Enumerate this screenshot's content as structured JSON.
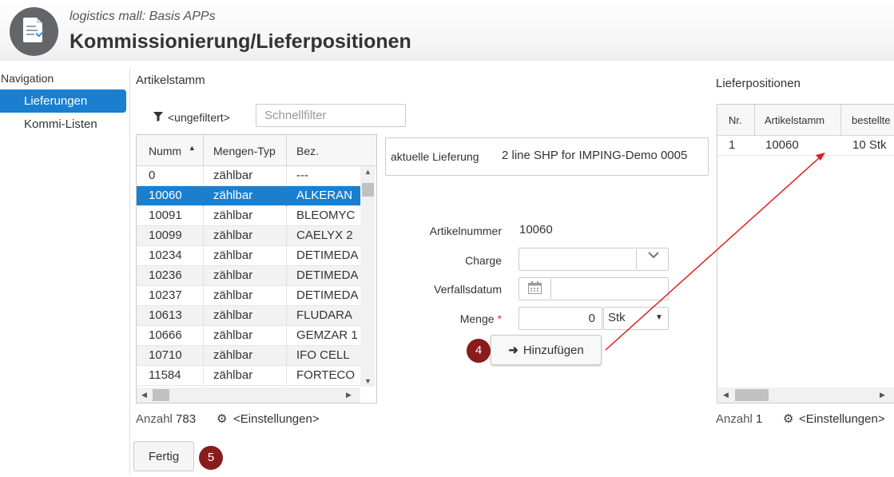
{
  "header": {
    "subtitle": "logistics mall: Basis APPs",
    "title": "Kommissionierung/Lieferpositionen"
  },
  "navigation": {
    "label": "Navigation",
    "items": [
      {
        "label": "Lieferungen",
        "active": true
      },
      {
        "label": "Kommi-Listen",
        "active": false
      }
    ]
  },
  "artikelstamm": {
    "title": "Artikelstamm",
    "filter_label": "<ungefiltert>",
    "quickfilter_placeholder": "Schnellfilter",
    "columns": [
      "Nummer",
      "Mengen-Typ",
      "Bez."
    ],
    "rows": [
      [
        "0",
        "zählbar",
        "---"
      ],
      [
        "10060",
        "zählbar",
        "ALKERAN"
      ],
      [
        "10091",
        "zählbar",
        "BLEOMYC"
      ],
      [
        "10099",
        "zählbar",
        "CAELYX 2"
      ],
      [
        "10234",
        "zählbar",
        "DETIMEDA"
      ],
      [
        "10236",
        "zählbar",
        "DETIMEDA"
      ],
      [
        "10237",
        "zählbar",
        "DETIMEDA"
      ],
      [
        "10613",
        "zählbar",
        "FLUDARA"
      ],
      [
        "10666",
        "zählbar",
        "GEMZAR 1"
      ],
      [
        "10710",
        "zählbar",
        "IFO CELL"
      ],
      [
        "11584",
        "zählbar",
        "FORTECO"
      ]
    ],
    "selected_row": 1,
    "count_label": "Anzahl",
    "count": "783",
    "settings_label": "<Einstellungen>"
  },
  "form": {
    "current_delivery_label": "aktuelle Lieferung",
    "current_delivery_value": "2 line SHP for IMPING-Demo 0005",
    "artikelnummer_label": "Artikelnummer",
    "artikelnummer_value": "10060",
    "charge_label": "Charge",
    "charge_value": "",
    "verfallsdatum_label": "Verfallsdatum",
    "verfallsdatum_value": "",
    "menge_label": "Menge",
    "menge_required": "*",
    "menge_value": "0",
    "unit": "Stk",
    "add_button": "Hinzufügen"
  },
  "lieferpositionen": {
    "title": "Lieferpositionen",
    "columns": [
      "Nr.",
      "Artikelstamm",
      "bestellte"
    ],
    "rows": [
      [
        "1",
        "10060",
        "10 Stk"
      ]
    ],
    "count_label": "Anzahl",
    "count": "1",
    "settings_label": "<Einstellungen>"
  },
  "footer": {
    "done_button": "Fertig"
  },
  "annotations": {
    "step_add": "4",
    "step_done": "5"
  },
  "colors": {
    "accent": "#1a7fcf",
    "badge": "#8a1c1c",
    "annotation_arrow": "#e02020"
  }
}
